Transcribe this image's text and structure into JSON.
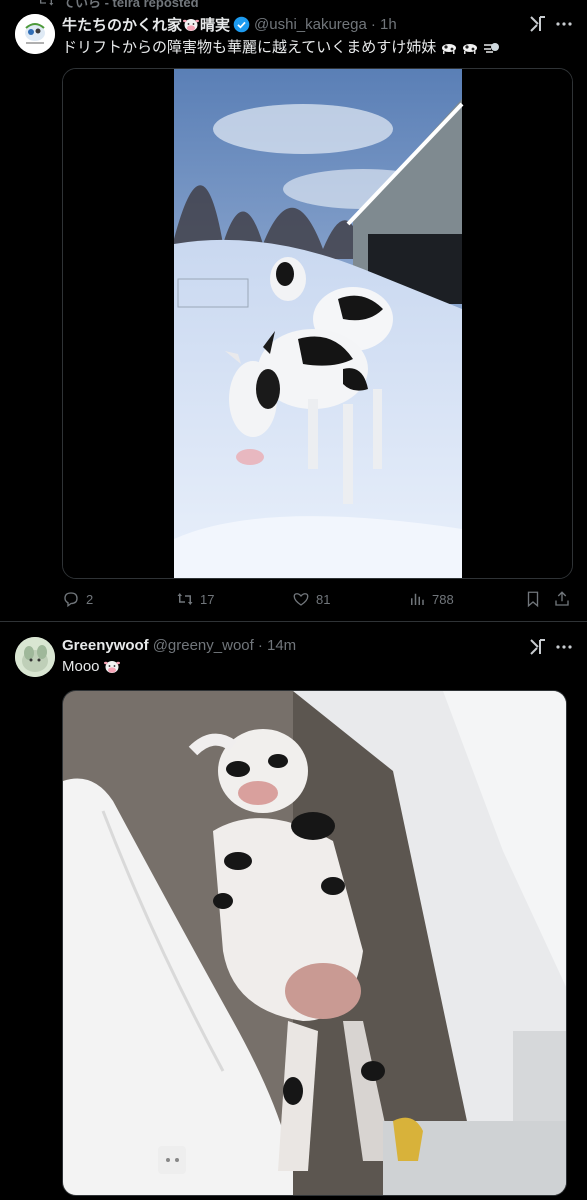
{
  "repost": {
    "text": "ていら - teira reposted"
  },
  "tweet1": {
    "display_name": "牛たちのかくれ家",
    "display_name_suffix": "晴実",
    "handle": "@ushi_kakurega",
    "time": "· 1h",
    "text": "ドリフトからの障害物も華麗に越えていくまめすけ姉妹",
    "media_type": "video",
    "actions": {
      "replies": "2",
      "reposts": "17",
      "likes": "81",
      "views": "788"
    }
  },
  "tweet2": {
    "display_name": "Greenywoof",
    "handle": "@greeny_woof",
    "time": "· 14m",
    "text": "Mooo",
    "media_type": "image"
  },
  "icons": [
    "retweet-icon",
    "verified-badge-icon",
    "grok-icon",
    "more-icon",
    "reply-icon",
    "like-icon",
    "views-icon",
    "bookmark-icon",
    "share-icon",
    "cow-face-emoji",
    "dash-emoji"
  ],
  "colors": {
    "background": "#000000",
    "text": "#e7e9ea",
    "muted": "#71767b",
    "verified": "#1d9bf0",
    "divider": "#2f3336"
  }
}
